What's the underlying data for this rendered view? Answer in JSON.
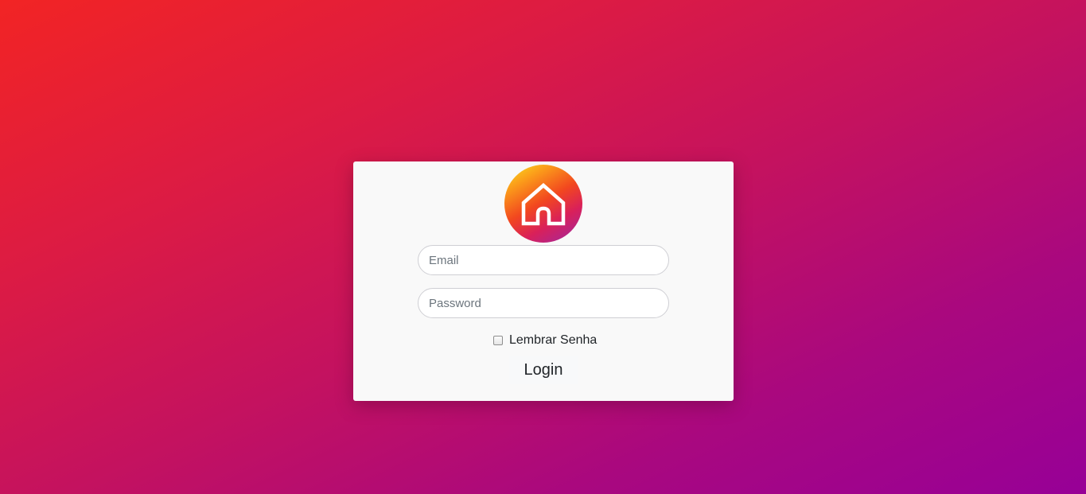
{
  "login_form": {
    "logo_icon": "house-icon",
    "email": {
      "placeholder": "Email",
      "value": ""
    },
    "password": {
      "placeholder": "Password",
      "value": ""
    },
    "remember": {
      "label": "Lembrar Senha",
      "checked": false
    },
    "submit_label": "Login"
  },
  "theme": {
    "background_gradient": [
      "#f22424",
      "#c4125f",
      "#970097"
    ],
    "logo_gradient": [
      "#f9e51f",
      "#f2471f",
      "#9c28a5"
    ],
    "card_background": "#f9f9f9"
  }
}
